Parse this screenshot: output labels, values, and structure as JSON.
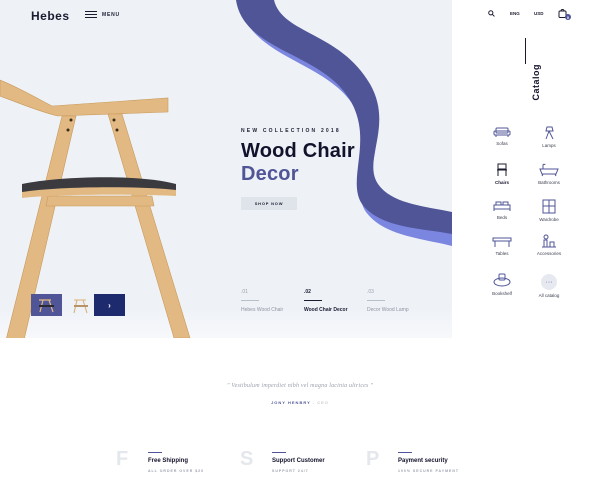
{
  "brand": {
    "logo": "Hebes"
  },
  "nav": {
    "menu_label": "MENU"
  },
  "utility": {
    "language": "ENG",
    "currency": "USD",
    "cart_count": "0"
  },
  "hero": {
    "eyebrow": "NEW COLLECTION 2018",
    "title_line1": "Wood Chair",
    "title_line2": "Decor",
    "cta": "SHOP NOW",
    "slides": [
      {
        "num": ".01",
        "name": "Hebes Wood Chair",
        "active": false
      },
      {
        "num": ".02",
        "name": "Wood Chair Decor",
        "active": true
      },
      {
        "num": ".03",
        "name": "Decor Wood Lamp",
        "active": false
      }
    ],
    "next_arrow": "›"
  },
  "catalog": {
    "title": "Catalog",
    "items": [
      {
        "label": "Sofas",
        "icon": "sofa-icon"
      },
      {
        "label": "Lamps",
        "icon": "lamp-icon"
      },
      {
        "label": "Chairs",
        "icon": "chair-icon",
        "active": true
      },
      {
        "label": "Bathrooms",
        "icon": "bathtub-icon"
      },
      {
        "label": "Beds",
        "icon": "bed-icon"
      },
      {
        "label": "Wardrobe",
        "icon": "wardrobe-icon"
      },
      {
        "label": "Tables",
        "icon": "table-icon"
      },
      {
        "label": "Accessories",
        "icon": "accessories-icon"
      },
      {
        "label": "Bookshelf",
        "icon": "bookshelf-icon"
      },
      {
        "label": "All catalog",
        "icon": "more-icon"
      }
    ],
    "more_glyph": "···"
  },
  "testimonial": {
    "quote": "\" Vestibulum imperdiet nibh vel magna lacinia ultrices \"",
    "author": "JONY HENBRY",
    "role": "- CEO"
  },
  "features": [
    {
      "letter": "F",
      "title": "Free Shipping",
      "subtitle": "ALL ORDER OVER $20"
    },
    {
      "letter": "S",
      "title": "Support Customer",
      "subtitle": "SUPPORT 24/7"
    },
    {
      "letter": "P",
      "title": "Payment security",
      "subtitle": "100% SECURE PAYMENT"
    }
  ],
  "colors": {
    "accent": "#4f5597",
    "accent_light": "#7b86e0",
    "navy": "#1e2a6e",
    "hero_bg": "#eef2f7"
  }
}
